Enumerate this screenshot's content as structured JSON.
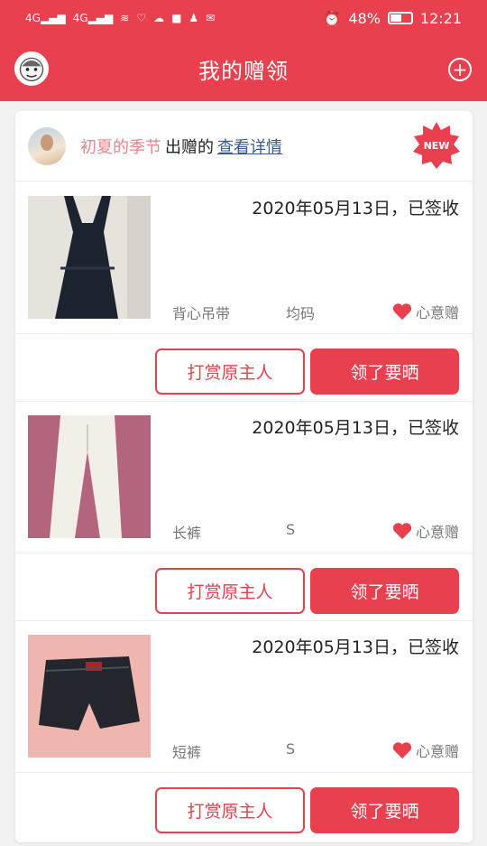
{
  "status_bar": {
    "signal_1": "4G",
    "signal_2": "4G",
    "battery": "48%",
    "time": "12:21"
  },
  "header": {
    "title": "我的赠领",
    "add_icon": "plus-circle-icon"
  },
  "giver": {
    "name": "初夏的季节",
    "verb": "出赠的",
    "link": "查看详情",
    "badge": "NEW"
  },
  "items": [
    {
      "date": "2020年05月13日，已签收",
      "name": "背心吊带",
      "size": "均码",
      "type": "心意赠",
      "reward_label": "打赏原主人",
      "share_label": "领了要晒"
    },
    {
      "date": "2020年05月13日，已签收",
      "name": "长裤",
      "size": "S",
      "type": "心意赠",
      "reward_label": "打赏原主人",
      "share_label": "领了要晒"
    },
    {
      "date": "2020年05月13日，已签收",
      "name": "短裤",
      "size": "S",
      "type": "心意赠",
      "reward_label": "打赏原主人",
      "share_label": "领了要晒"
    }
  ],
  "colors": {
    "brand": "#e8404e",
    "giver_name": "#e8838b",
    "link": "#3b5a86"
  }
}
